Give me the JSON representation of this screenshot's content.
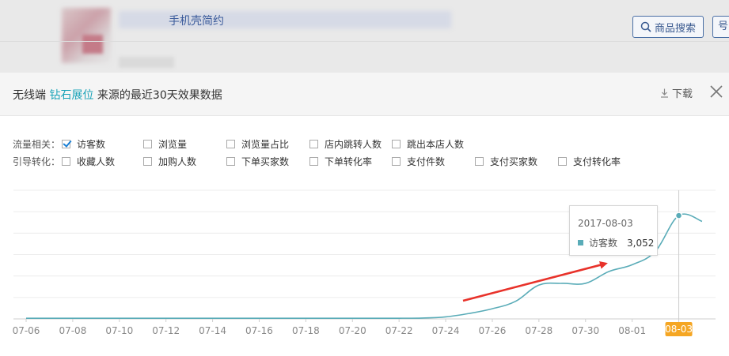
{
  "background": {
    "product_title": "手机壳简约",
    "search_button": "商品搜索",
    "extra_button": "号"
  },
  "modal": {
    "title_prefix": "无线端",
    "title_highlight": "钻石展位",
    "title_suffix": "来源的最近30天效果数据",
    "download_label": "下载",
    "close_icon": "close-icon"
  },
  "filters": {
    "traffic": {
      "label": "流量相关：",
      "options": [
        {
          "label": "访客数",
          "checked": true
        },
        {
          "label": "浏览量",
          "checked": false
        },
        {
          "label": "浏览量占比",
          "checked": false
        },
        {
          "label": "店内跳转人数",
          "checked": false
        },
        {
          "label": "跳出本店人数",
          "checked": false
        }
      ]
    },
    "conversion": {
      "label": "引导转化：",
      "options": [
        {
          "label": "收藏人数",
          "checked": false
        },
        {
          "label": "加购人数",
          "checked": false
        },
        {
          "label": "下单买家数",
          "checked": false
        },
        {
          "label": "下单转化率",
          "checked": false
        },
        {
          "label": "支付件数",
          "checked": false
        },
        {
          "label": "支付买家数",
          "checked": false
        },
        {
          "label": "支付转化率",
          "checked": false
        }
      ]
    }
  },
  "tooltip": {
    "date": "2017-08-03",
    "series_name": "访客数",
    "value_text": "3,052"
  },
  "chart_data": {
    "type": "line",
    "x": [
      "07-06",
      "07-07",
      "07-08",
      "07-09",
      "07-10",
      "07-11",
      "07-12",
      "07-13",
      "07-14",
      "07-15",
      "07-16",
      "07-17",
      "07-18",
      "07-19",
      "07-20",
      "07-21",
      "07-22",
      "07-23",
      "07-24",
      "07-25",
      "07-26",
      "07-27",
      "07-28",
      "07-29",
      "07-30",
      "07-31",
      "08-01",
      "08-02",
      "08-03",
      "08-04"
    ],
    "x_tick_labels": [
      "07-06",
      "07-08",
      "07-10",
      "07-12",
      "07-14",
      "07-16",
      "07-18",
      "07-20",
      "07-22",
      "07-24",
      "07-26",
      "07-28",
      "07-30",
      "08-01",
      "08-03"
    ],
    "highlighted_tick": "08-03",
    "series": [
      {
        "name": "访客数",
        "values": [
          20,
          20,
          20,
          20,
          20,
          20,
          20,
          20,
          20,
          20,
          20,
          20,
          20,
          20,
          20,
          20,
          20,
          25,
          60,
          160,
          300,
          520,
          1000,
          1050,
          1050,
          1400,
          1600,
          2000,
          3052,
          2880
        ]
      }
    ],
    "ylim": [
      0,
      3800
    ],
    "grid": true,
    "line_color": "#5aacb8",
    "highlight_color": "#f5a623",
    "annotation": "red-arrow"
  }
}
